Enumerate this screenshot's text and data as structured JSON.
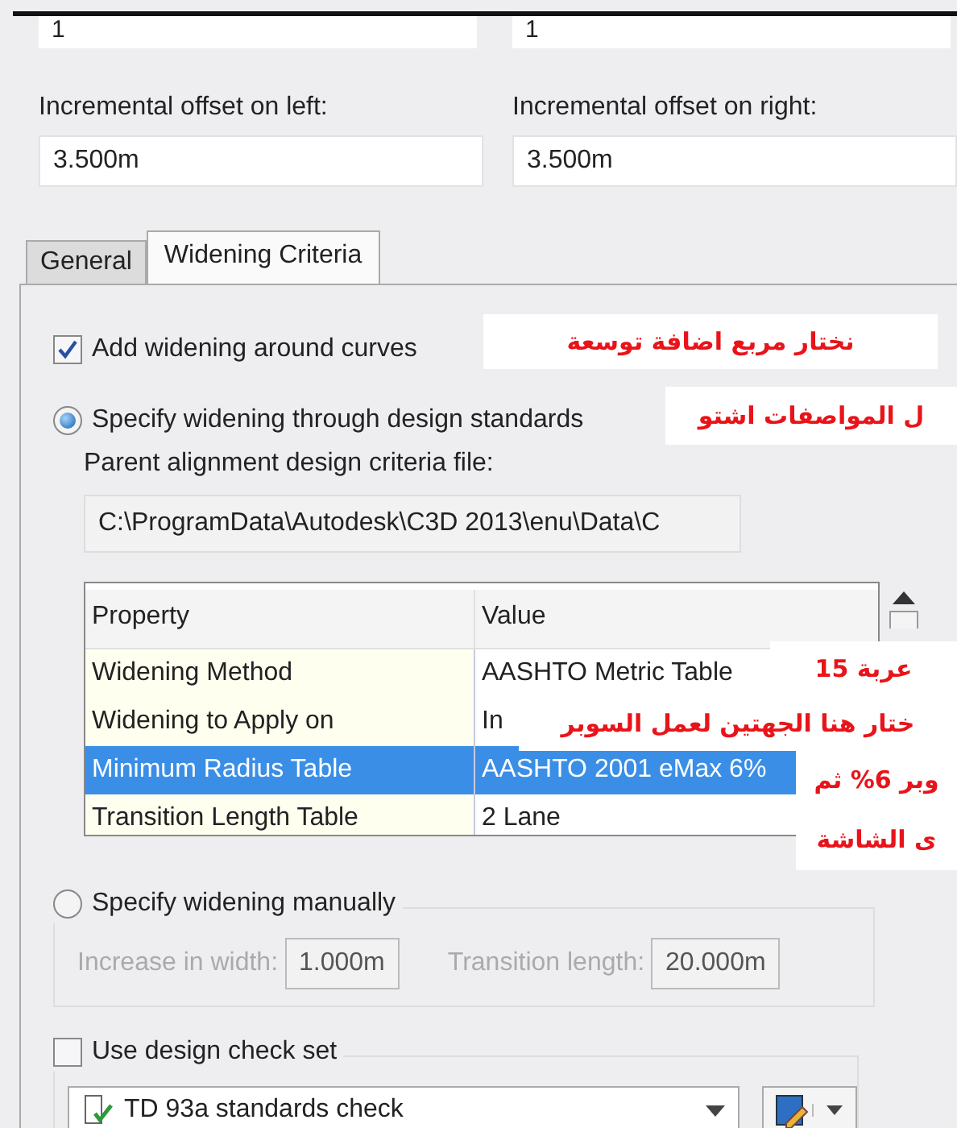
{
  "top_fields": [
    {
      "value": "1"
    },
    {
      "value": "1"
    }
  ],
  "offsets": [
    {
      "label": "Incremental offset on left:",
      "value": "3.500m"
    },
    {
      "label": "Incremental offset on right:",
      "value": "3.500m"
    }
  ],
  "tabs": [
    {
      "label": "General",
      "selected": false
    },
    {
      "label": "Widening Criteria",
      "selected": true
    }
  ],
  "add_widening": {
    "label": "Add widening around curves",
    "checked": true
  },
  "standards_option": {
    "label": "Specify widening through design standards",
    "selected": true
  },
  "criteria_file": {
    "label": "Parent alignment design criteria file:",
    "value": "C:\\ProgramData\\Autodesk\\C3D 2013\\enu\\Data\\C"
  },
  "table": {
    "columns": [
      "Property",
      "Value"
    ],
    "rows": [
      {
        "cells": [
          "Widening Method",
          "AASHTO Metric Table"
        ],
        "selected": false
      },
      {
        "cells": [
          "Widening to Apply on",
          "In"
        ],
        "selected": false
      },
      {
        "cells": [
          "Minimum Radius Table",
          "AASHTO 2001 eMax 6%"
        ],
        "selected": true
      },
      {
        "cells": [
          "Transition Length Table",
          "2 Lane"
        ],
        "selected": false
      }
    ]
  },
  "manual_option": {
    "label": "Specify widening manually",
    "selected": false,
    "fields": [
      {
        "label": "Increase in width:",
        "value": "1.000m"
      },
      {
        "label": "Transition length:",
        "value": "20.000m"
      }
    ]
  },
  "design_check": {
    "label": "Use design check set",
    "checked": false,
    "value": "TD 93a standards check"
  },
  "annotations": [
    {
      "text": "نختار مربع اضافة توسعة"
    },
    {
      "text": "ل المواصفات اشتو"
    },
    {
      "text": "عربة 15"
    },
    {
      "text": "ختار هنا الجهتين لعمل السوبر"
    },
    {
      "text": "وبر 6% ثم"
    },
    {
      "text": "ى الشاشة"
    }
  ]
}
